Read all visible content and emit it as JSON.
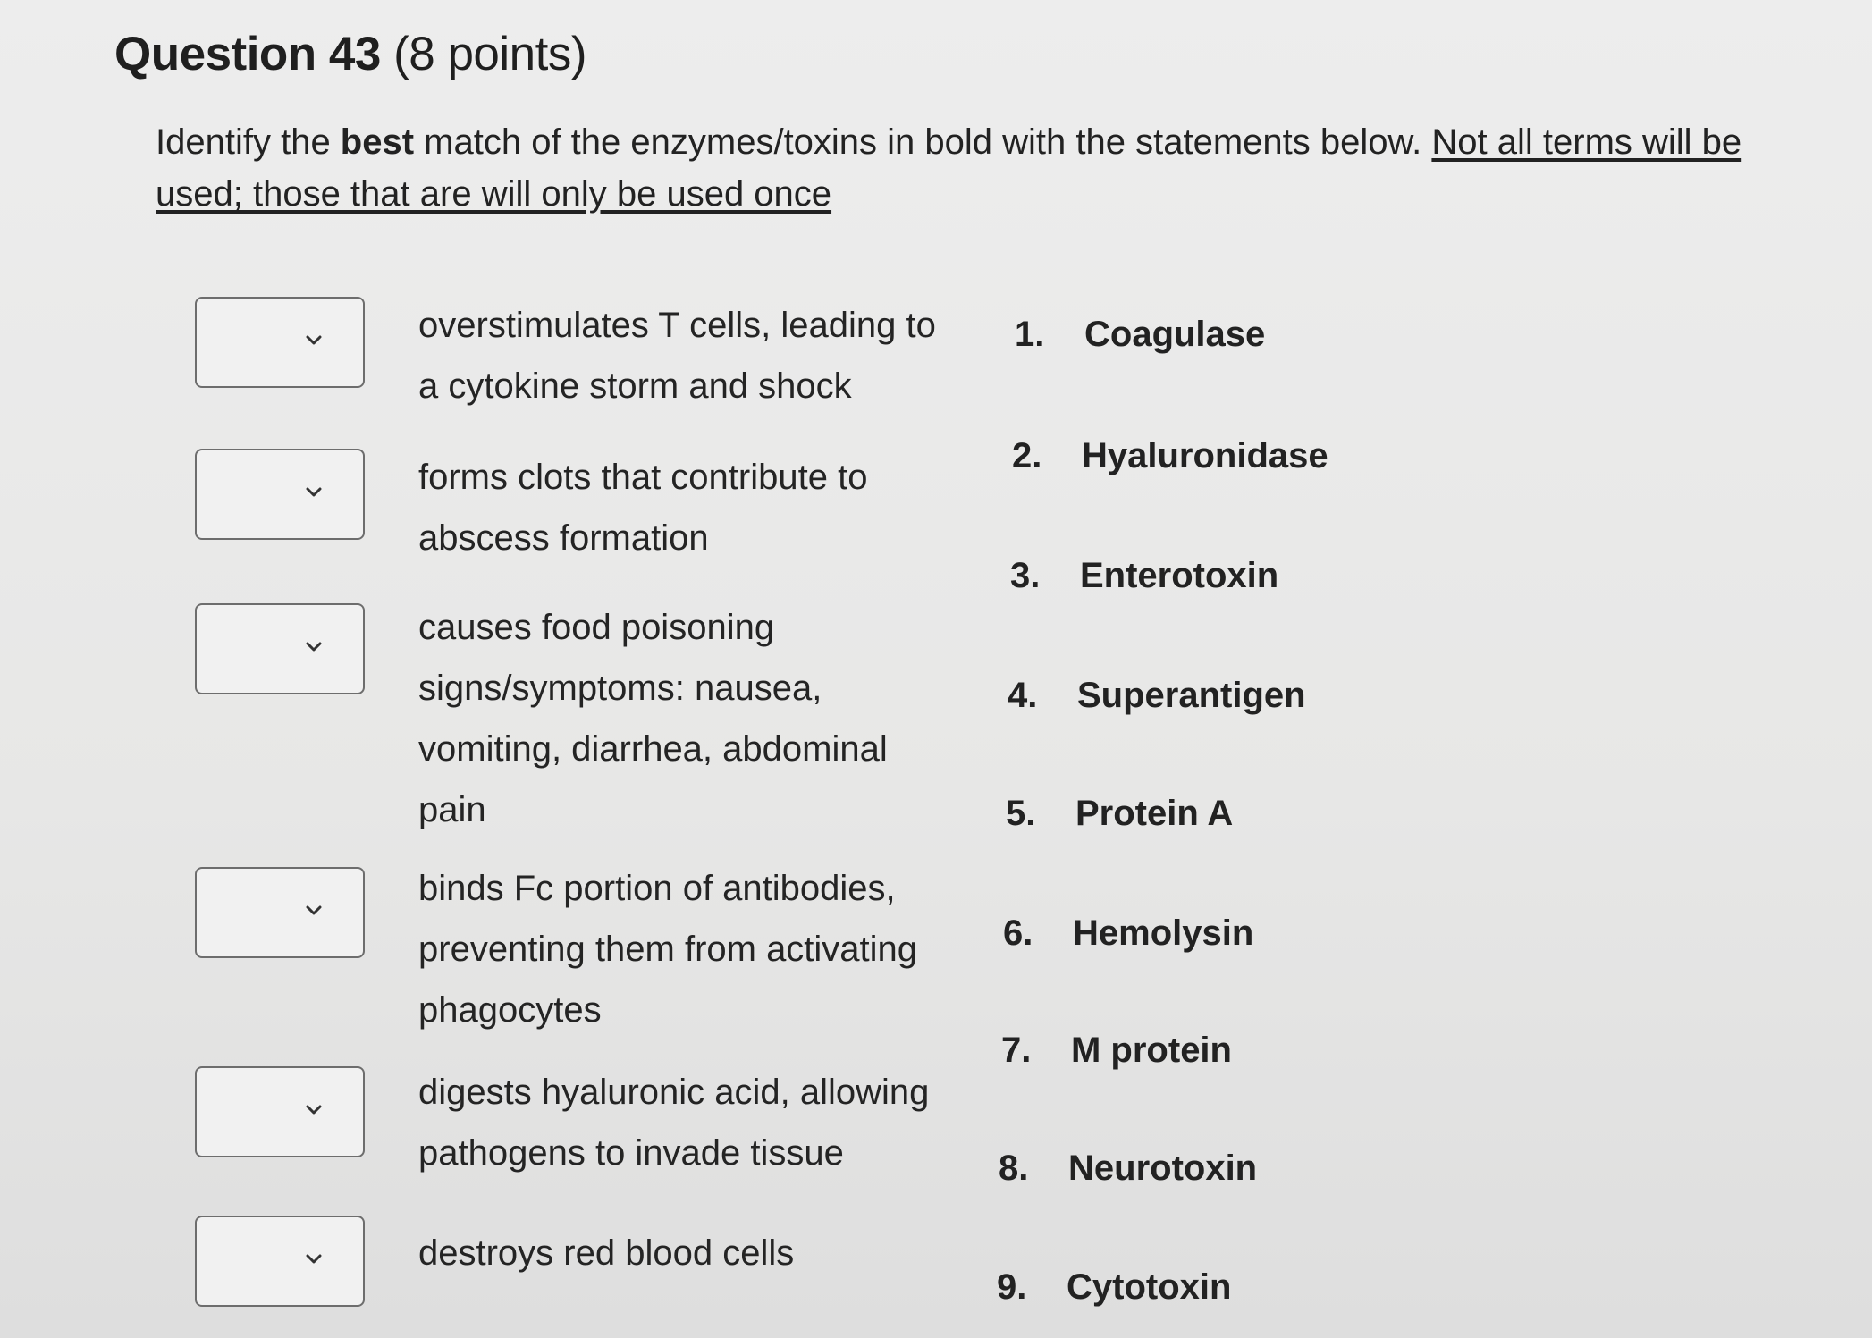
{
  "question": {
    "title": "Question 43",
    "points": "(8 points)"
  },
  "instructions": {
    "part1": "Identify the ",
    "bold": "best",
    "part2": " match of the enzymes/toxins in bold with the statements below.  ",
    "underlined": "Not all terms will be used; those that are will only be used once"
  },
  "matches": [
    {
      "statement": "overstimulates T cells, leading to a cytokine storm and shock",
      "selected": ""
    },
    {
      "statement": "forms clots that contribute to abscess formation",
      "selected": ""
    },
    {
      "statement": "causes food poisoning signs/symptoms: nausea, vomiting, diarrhea, abdominal pain",
      "selected": ""
    },
    {
      "statement": "binds Fc portion of antibodies, preventing them from activating phagocytes",
      "selected": ""
    },
    {
      "statement": "digests hyaluronic acid, allowing pathogens to invade tissue",
      "selected": ""
    },
    {
      "statement": "destroys red blood cells",
      "selected": ""
    }
  ],
  "terms": [
    {
      "number": "1.",
      "name": "Coagulase"
    },
    {
      "number": "2.",
      "name": "Hyaluronidase"
    },
    {
      "number": "3.",
      "name": "Enterotoxin"
    },
    {
      "number": "4.",
      "name": "Superantigen"
    },
    {
      "number": "5.",
      "name": "Protein A"
    },
    {
      "number": "6.",
      "name": "Hemolysin"
    },
    {
      "number": "7.",
      "name": "M protein"
    },
    {
      "number": "8.",
      "name": "Neurotoxin"
    },
    {
      "number": "9.",
      "name": "Cytotoxin"
    }
  ],
  "icons": {
    "dropdown": "chevron-down-icon"
  },
  "colors": {
    "background": "#e8e8e8",
    "text": "#222222",
    "dropdown_border": "#6d6d6d"
  }
}
